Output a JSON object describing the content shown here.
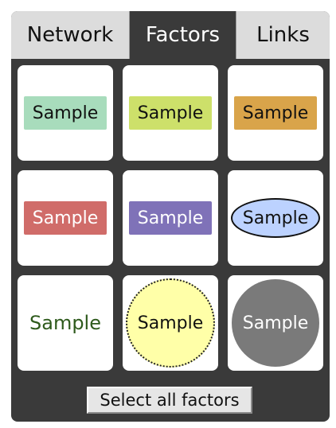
{
  "tabs": [
    {
      "label": "Network",
      "active": false
    },
    {
      "label": "Factors",
      "active": true
    },
    {
      "label": "Links",
      "active": false
    }
  ],
  "factors": [
    {
      "label": "Sample",
      "shape": "rectangle",
      "fill": "#a8dcbc",
      "text_color": "#111111"
    },
    {
      "label": "Sample",
      "shape": "rectangle",
      "fill": "#cde06a",
      "text_color": "#111111"
    },
    {
      "label": "Sample",
      "shape": "rectangle",
      "fill": "#d9a44a",
      "text_color": "#111111"
    },
    {
      "label": "Sample",
      "shape": "rectangle",
      "fill": "#d06c69",
      "text_color": "#ffffff"
    },
    {
      "label": "Sample",
      "shape": "rectangle",
      "fill": "#7f72b8",
      "text_color": "#ffffff"
    },
    {
      "label": "Sample",
      "shape": "ellipse",
      "fill": "#bcd2ff",
      "text_color": "#111111"
    },
    {
      "label": "Sample",
      "shape": "text",
      "fill": "none",
      "text_color": "#2e5a1c"
    },
    {
      "label": "Sample",
      "shape": "dotted-circle",
      "fill": "#ffffa8",
      "text_color": "#111111"
    },
    {
      "label": "Sample",
      "shape": "circle",
      "fill": "#7a7a7a",
      "text_color": "#ffffff"
    }
  ],
  "actions": {
    "select_all_label": "Select all factors"
  },
  "colors": {
    "panel_background": "#3a3a3a",
    "inactive_tab": "#dcdcdc",
    "card": "#ffffff"
  }
}
